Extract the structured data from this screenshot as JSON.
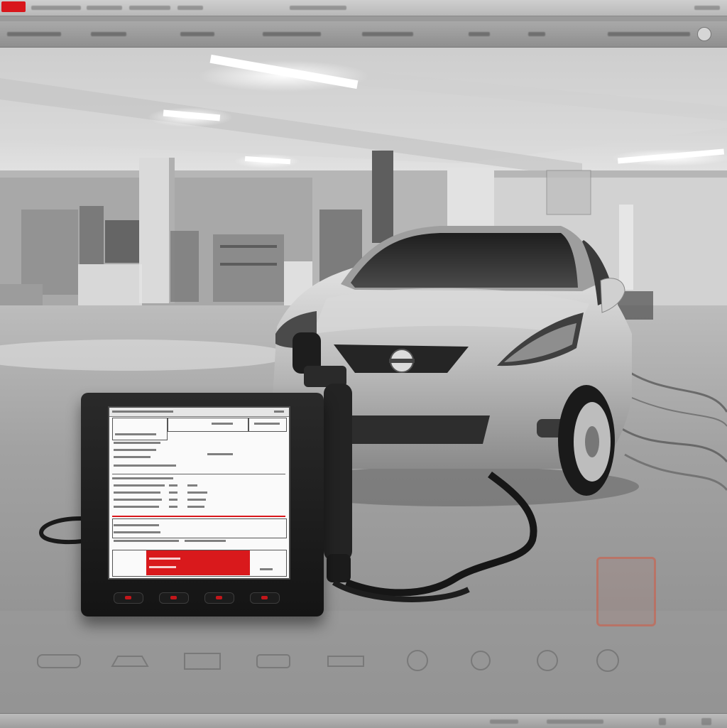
{
  "scene": {
    "brand_color": "#d8161b",
    "style": "grayscale with red accents",
    "icons": [
      "car-icon",
      "obd-scanner-icon",
      "diagnostic-emblem-icon"
    ]
  }
}
